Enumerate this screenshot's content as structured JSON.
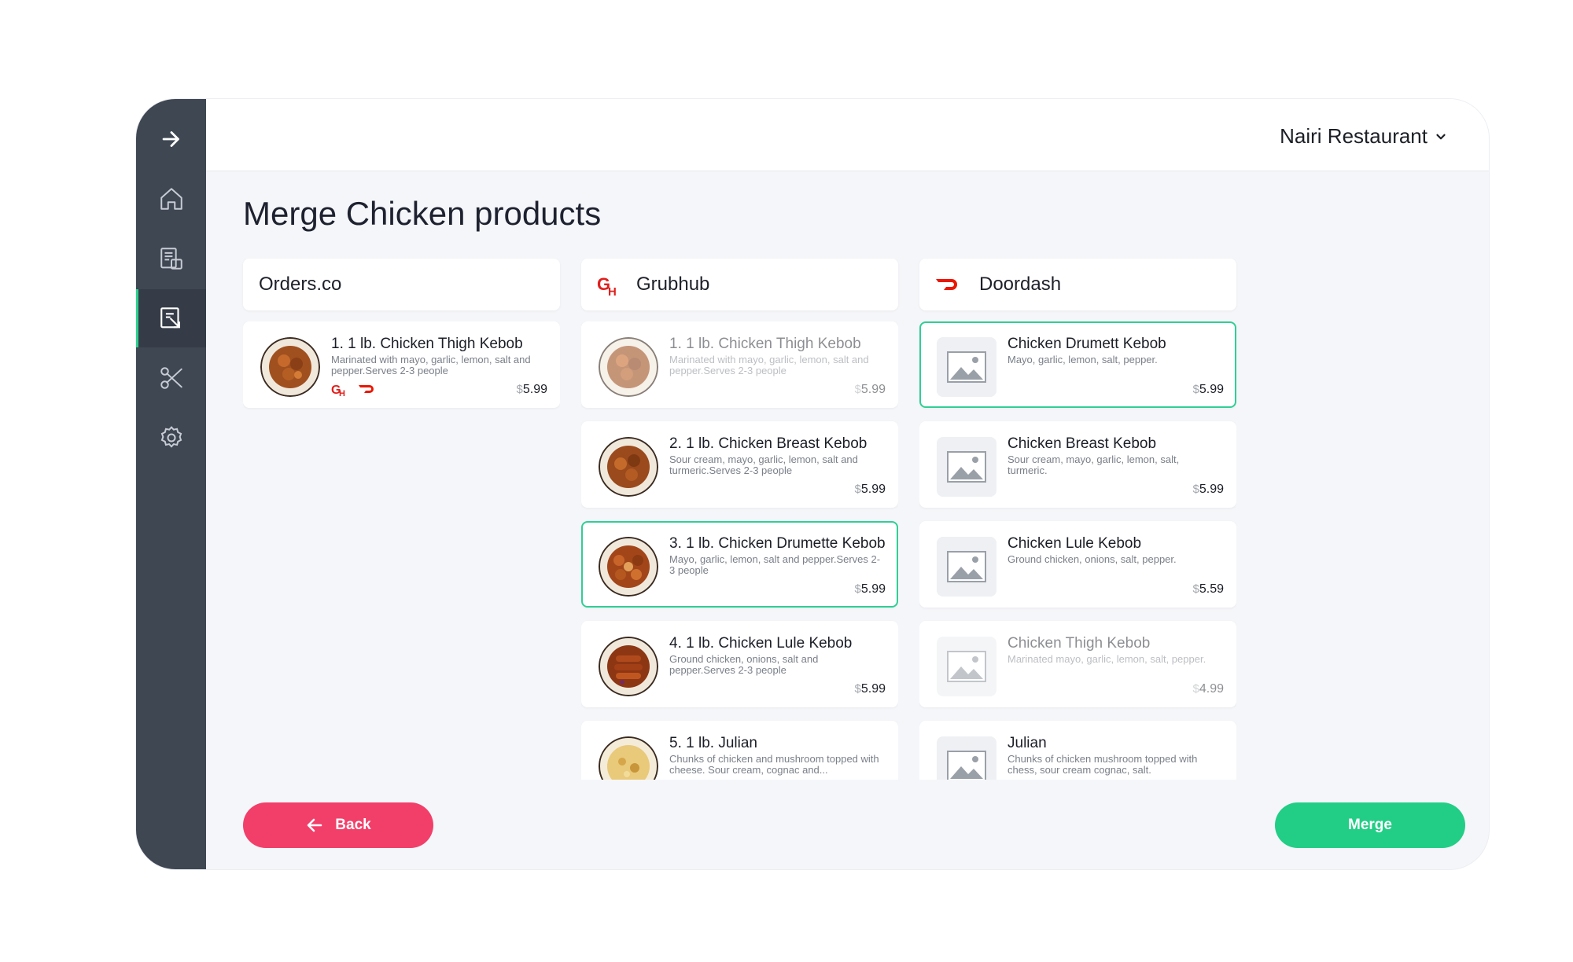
{
  "header": {
    "restaurant": "Nairi Restaurant"
  },
  "page": {
    "title": "Merge Chicken products"
  },
  "columns": [
    {
      "name": "Orders.co",
      "items": [
        {
          "title": "1. 1 lb. Chicken Thigh Kebob",
          "desc": "Marinated with mayo, garlic, lemon, salt and pepper.Serves 2-3 people",
          "currency": "$",
          "price": "5.99"
        }
      ]
    },
    {
      "name": "Grubhub",
      "items": [
        {
          "title": "1. 1 lb. Chicken Thigh Kebob",
          "desc": "Marinated with mayo, garlic, lemon, salt and pepper.Serves 2-3 people",
          "currency": "$",
          "price": "5.99"
        },
        {
          "title": "2. 1 lb. Chicken Breast Kebob",
          "desc": "Sour cream, mayo, garlic, lemon, salt and turmeric.Serves 2-3 people",
          "currency": "$",
          "price": "5.99"
        },
        {
          "title": "3. 1 lb. Chicken Drumette Kebob",
          "desc": "Mayo, garlic, lemon, salt and pepper.Serves 2-3 people",
          "currency": "$",
          "price": "5.99"
        },
        {
          "title": "4. 1 lb. Chicken Lule Kebob",
          "desc": "Ground chicken, onions, salt and pepper.Serves 2-3 people",
          "currency": "$",
          "price": "5.99"
        },
        {
          "title": "5. 1 lb. Julian",
          "desc": "Chunks of chicken and mushroom topped with cheese. Sour cream, cognac and...",
          "currency": "$",
          "price": ""
        }
      ]
    },
    {
      "name": "Doordash",
      "items": [
        {
          "title": "Chicken Drumett Kebob",
          "desc": "Mayo, garlic, lemon, salt, pepper.",
          "currency": "$",
          "price": "5.99"
        },
        {
          "title": "Chicken Breast Kebob",
          "desc": "Sour cream, mayo, garlic, lemon, salt, turmeric.",
          "currency": "$",
          "price": "5.99"
        },
        {
          "title": "Chicken Lule Kebob",
          "desc": "Ground chicken, onions, salt, pepper.",
          "currency": "$",
          "price": "5.59"
        },
        {
          "title": "Chicken Thigh Kebob",
          "desc": "Marinated mayo, garlic, lemon, salt, pepper.",
          "currency": "$",
          "price": "4.99"
        },
        {
          "title": "Julian",
          "desc": "Chunks of chicken mushroom topped with chess, sour cream cognac, salt.",
          "currency": "$",
          "price": ""
        }
      ]
    }
  ],
  "buttons": {
    "back": "Back",
    "merge": "Merge"
  },
  "colors": {
    "sidebar": "#3f4753",
    "accent": "#22ce86",
    "danger": "#f23f6a",
    "grubhub": "#e0201d",
    "doordash": "#eb1700"
  },
  "icons": [
    "arrow-right-icon",
    "home-icon",
    "orders-icon",
    "merge-products-icon",
    "tools-icon",
    "settings-icon",
    "chevron-down-icon",
    "grubhub-logo-icon",
    "doordash-logo-icon",
    "image-placeholder-icon",
    "arrow-left-icon"
  ]
}
